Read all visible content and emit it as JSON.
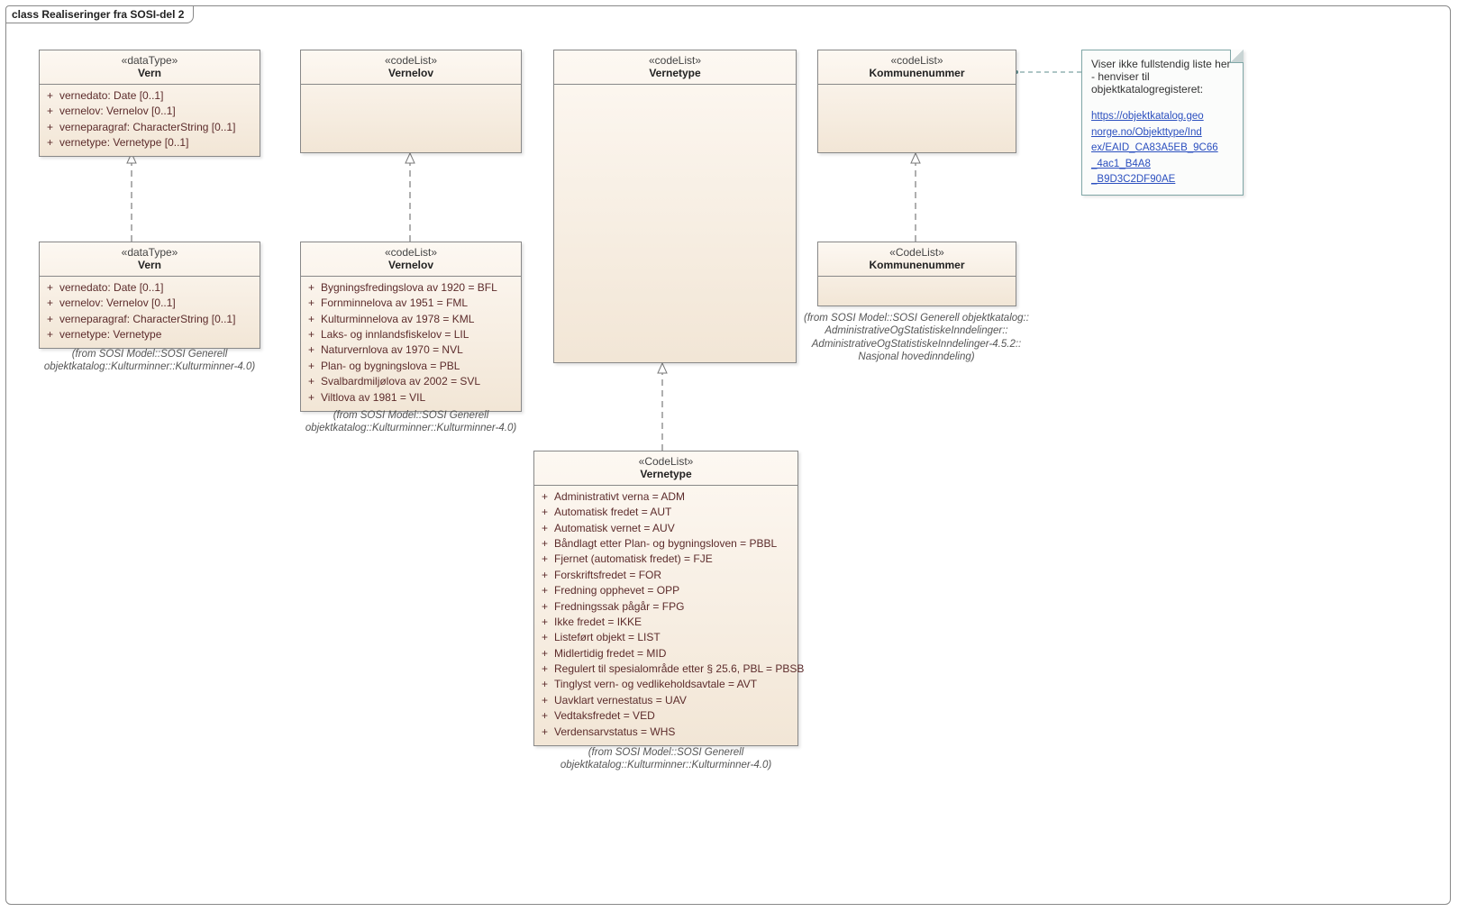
{
  "frame": {
    "title_kw": "class",
    "title": "Realiseringer fra SOSI-del 2"
  },
  "vern_top": {
    "stereo": "«dataType»",
    "name": "Vern",
    "attrs": [
      "vernedato: Date [0..1]",
      "vernelov: Vernelov [0..1]",
      "verneparagraf: CharacterString [0..1]",
      "vernetype: Vernetype [0..1]"
    ]
  },
  "vern_bottom": {
    "stereo": "«dataType»",
    "name": "Vern",
    "attrs": [
      "vernedato: Date [0..1]",
      "vernelov: Vernelov [0..1]",
      "verneparagraf: CharacterString [0..1]",
      "vernetype: Vernetype"
    ],
    "from": "(from SOSI Model::SOSI Generell objektkatalog::Kulturminner::Kulturminner-4.0)"
  },
  "vernelov_top": {
    "stereo": "«codeList»",
    "name": "Vernelov"
  },
  "vernelov_bottom": {
    "stereo": "«codeList»",
    "name": "Vernelov",
    "attrs": [
      "Bygningsfredingslova av 1920 = BFL",
      "Fornminnelova av 1951 = FML",
      "Kulturminnelova av 1978 = KML",
      "Laks- og innlandsfiskelov = LIL",
      "Naturvernlova av 1970 = NVL",
      "Plan- og bygningslova = PBL",
      "Svalbardmiljølova av 2002 = SVL",
      "Viltlova av 1981 = VIL"
    ],
    "from": "(from SOSI Model::SOSI Generell objektkatalog::Kulturminner::Kulturminner-4.0)"
  },
  "vernetype_top": {
    "stereo": "«codeList»",
    "name": "Vernetype"
  },
  "vernetype_bottom": {
    "stereo": "«CodeList»",
    "name": "Vernetype",
    "attrs": [
      "Administrativt verna = ADM",
      "Automatisk fredet = AUT",
      "Automatisk vernet = AUV",
      "Båndlagt etter Plan- og bygningsloven = PBBL",
      "Fjernet (automatisk fredet) = FJE",
      "Forskriftsfredet = FOR",
      "Fredning opphevet = OPP",
      "Fredningssak pågår = FPG",
      "Ikke fredet = IKKE",
      "Listeført objekt = LIST",
      "Midlertidig fredet = MID",
      "Regulert til spesialområde etter § 25.6, PBL = PBSB",
      "Tinglyst vern- og vedlikeholdsavtale = AVT",
      "Uavklart vernestatus = UAV",
      "Vedtaksfredet = VED",
      "Verdensarvstatus = WHS"
    ],
    "from": "(from SOSI Model::SOSI Generell objektkatalog::Kulturminner::Kulturminner-4.0)"
  },
  "kommune_top": {
    "stereo": "«codeList»",
    "name": "Kommunenummer"
  },
  "kommune_bottom": {
    "stereo": "«CodeList»",
    "name": "Kommunenummer",
    "from_line1": "(from SOSI Model::SOSI Generell objektkatalog::",
    "from_line2": "AdministrativeOgStatistiskeInndelinger::",
    "from_line3": "AdministrativeOgStatistiskeInndelinger-4.5.2::",
    "from_line4": "Nasjonal hovedinndeling)"
  },
  "note": {
    "text": "Viser ikke fullstendig liste her - henviser til objektkatalogregisteret:",
    "link_l1": "https://objektkatalog.geo",
    "link_l2": "norge.no/Objekttype/Ind",
    "link_l3": "ex/EAID_CA83A5EB_9C66",
    "link_l4": "_4ac1_B4A8",
    "link_l5": "_B9D3C2DF90AE",
    "href": "https://objektkatalog.geonorge.no/Objekttype/Index/EAID_CA83A5EB_9C66_4ac1_B4A8_B9D3C2DF90AE"
  }
}
